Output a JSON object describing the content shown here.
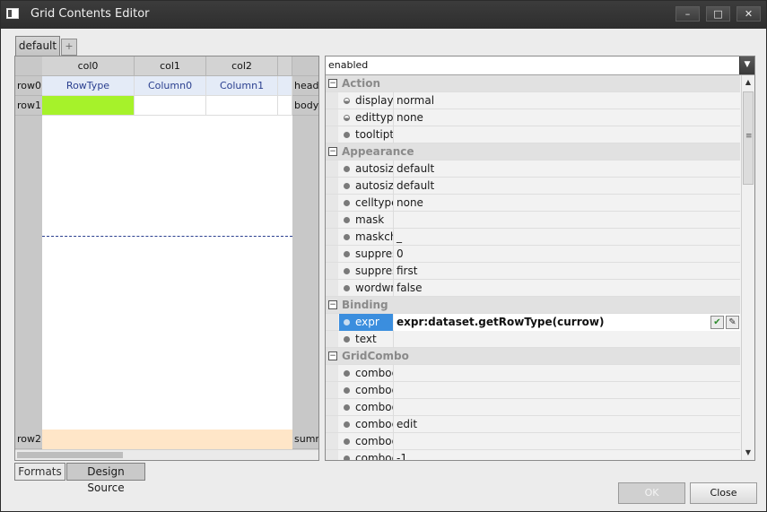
{
  "window": {
    "title": "Grid Contents Editor"
  },
  "controls": {
    "minimize": "–",
    "maximize": "□",
    "close": "✕"
  },
  "tabs": {
    "main": "default",
    "add": "+"
  },
  "grid": {
    "col_headers": [
      "col0",
      "col1",
      "col2"
    ],
    "row_headers": [
      "row0",
      "row1",
      "row2"
    ],
    "band_labels": [
      "head",
      "body",
      "summ"
    ],
    "head_cells": [
      "RowType",
      "Column0",
      "Column1"
    ],
    "colors": {
      "selected_cell": "#a6f22a",
      "summary_band": "#ffe6c8",
      "divider": "#2a3f8f"
    }
  },
  "bottom_tabs": {
    "formats": "Formats",
    "source": "Design Source"
  },
  "properties": {
    "combo_value": "enabled",
    "categories": {
      "action": "Action",
      "appearance": "Appearance",
      "binding": "Binding",
      "gridcombo": "GridCombo"
    },
    "action": [
      {
        "name": "displaytype",
        "value": "normal"
      },
      {
        "name": "edittype",
        "value": "none"
      },
      {
        "name": "tooltiptext",
        "value": ""
      }
    ],
    "appearance": [
      {
        "name": "autosizecol",
        "value": "default"
      },
      {
        "name": "autosizerow",
        "value": "default"
      },
      {
        "name": "celltype",
        "value": "none"
      },
      {
        "name": "mask",
        "value": ""
      },
      {
        "name": "maskchar",
        "value": "_"
      },
      {
        "name": "suppress",
        "value": "0"
      },
      {
        "name": "suppressalign",
        "value": "first"
      },
      {
        "name": "wordwrap",
        "value": "false"
      }
    ],
    "binding": [
      {
        "name": "expr",
        "value": "expr:dataset.getRowType(currow)"
      },
      {
        "name": "text",
        "value": ""
      }
    ],
    "gridcombo": [
      {
        "name": "combocodecol",
        "value": ""
      },
      {
        "name": "combodatacol",
        "value": ""
      },
      {
        "name": "combodataset",
        "value": ""
      },
      {
        "name": "comboedittype",
        "value": "edit"
      },
      {
        "name": "combodisplay",
        "value": ""
      },
      {
        "name": "combodisplayrowcount",
        "value": "-1"
      }
    ]
  },
  "buttons": {
    "ok": "OK",
    "close": "Close"
  }
}
